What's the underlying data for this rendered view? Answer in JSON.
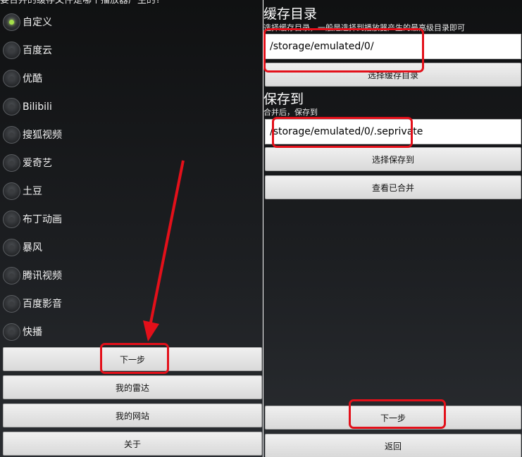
{
  "left": {
    "prompt": "要合并的缓存文件是哪个播放器产生的?",
    "options": [
      {
        "label": "自定义",
        "checked": true
      },
      {
        "label": "百度云",
        "checked": false
      },
      {
        "label": "优酷",
        "checked": false
      },
      {
        "label": "Bilibili",
        "checked": false
      },
      {
        "label": "搜狐视频",
        "checked": false
      },
      {
        "label": "爱奇艺",
        "checked": false
      },
      {
        "label": "土豆",
        "checked": false
      },
      {
        "label": "布丁动画",
        "checked": false
      },
      {
        "label": "暴风",
        "checked": false
      },
      {
        "label": "腾讯视频",
        "checked": false
      },
      {
        "label": "百度影音",
        "checked": false
      },
      {
        "label": "快播",
        "checked": false
      }
    ],
    "buttons": {
      "next": "下一步",
      "my_radar": "我的雷达",
      "my_website": "我的网站",
      "about": "关于"
    }
  },
  "right": {
    "cache_title": "缓存目录",
    "cache_hint": "选择缓存目录，一般是选择到播放器产生的最高级目录即可",
    "cache_path": "/storage/emulated/0/",
    "choose_cache_button": "选择缓存目录",
    "save_title": "保存到",
    "save_hint": "合并后，保存到",
    "save_path": "/storage/emulated/0/.seprivate",
    "choose_save_button": "选择保存到",
    "view_merged_button": "查看已合并",
    "next_button": "下一步",
    "back_button": "返回"
  },
  "colors": {
    "highlight": "#e3101a",
    "radio_checked": "#a5e04a"
  }
}
